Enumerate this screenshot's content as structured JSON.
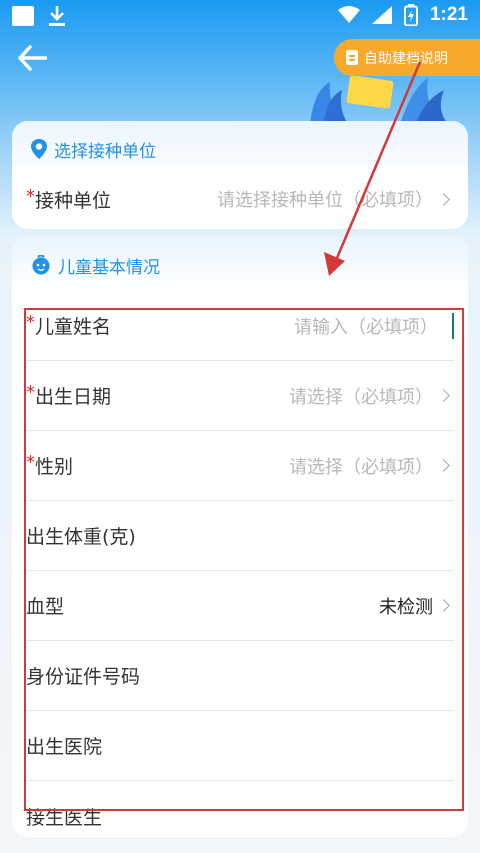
{
  "status_bar": {
    "time": "1:21"
  },
  "header": {
    "help_button_label": "自助建档说明"
  },
  "unit_card": {
    "title": "选择接种单位",
    "field_label": "接种单位",
    "field_placeholder": "请选择接种单位（必填项）"
  },
  "child_card": {
    "title": "儿童基本情况",
    "rows": [
      {
        "label": "儿童姓名",
        "required": "*",
        "value": "请输入（必填项）"
      },
      {
        "label": "出生日期",
        "required": "*",
        "value": "请选择（必填项）"
      },
      {
        "label": "性别",
        "required": "*",
        "value": "请选择（必填项）"
      },
      {
        "label": "出生体重(克)",
        "required": "",
        "value": ""
      },
      {
        "label": "血型",
        "required": "",
        "value": "未检测"
      },
      {
        "label": "身份证件号码",
        "required": "",
        "value": ""
      },
      {
        "label": "出生医院",
        "required": "",
        "value": ""
      },
      {
        "label": "接生医生",
        "required": "",
        "value": ""
      }
    ]
  },
  "colors": {
    "primary": "#2192e8",
    "accent_orange": "#f7a92c",
    "required_red": "#e02b2b",
    "annotation_red": "#d23a3a"
  }
}
